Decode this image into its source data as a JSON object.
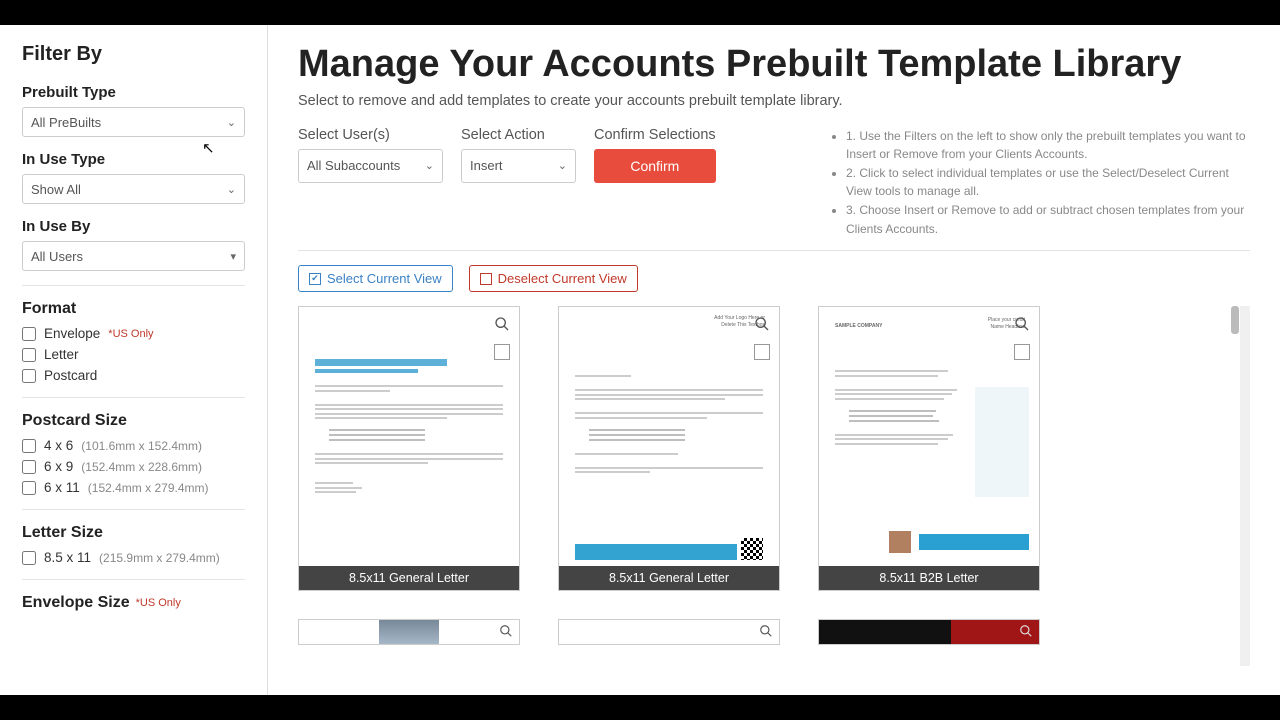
{
  "sidebar": {
    "title": "Filter By",
    "prebuilt_type": {
      "label": "Prebuilt Type",
      "value": "All PreBuilts"
    },
    "in_use_type": {
      "label": "In Use Type",
      "value": "Show All"
    },
    "in_use_by": {
      "label": "In Use By",
      "value": "All Users"
    },
    "format": {
      "title": "Format",
      "options": [
        {
          "label": "Envelope",
          "note": "*US Only"
        },
        {
          "label": "Letter"
        },
        {
          "label": "Postcard"
        }
      ]
    },
    "postcard_size": {
      "title": "Postcard Size",
      "options": [
        {
          "label": "4 x 6",
          "dims": "(101.6mm x 152.4mm)"
        },
        {
          "label": "6 x 9",
          "dims": "(152.4mm x 228.6mm)"
        },
        {
          "label": "6 x 11",
          "dims": "(152.4mm x 279.4mm)"
        }
      ]
    },
    "letter_size": {
      "title": "Letter Size",
      "options": [
        {
          "label": "8.5 x 11",
          "dims": "(215.9mm x 279.4mm)"
        }
      ]
    },
    "envelope_size": {
      "title": "Envelope Size",
      "note": "*US Only"
    }
  },
  "main": {
    "title": "Manage Your Accounts Prebuilt Template Library",
    "subtitle": "Select to remove and add templates to create your accounts prebuilt template library.",
    "select_users": {
      "label": "Select User(s)",
      "value": "All Subaccounts"
    },
    "select_action": {
      "label": "Select Action",
      "value": "Insert"
    },
    "confirm_label_section": "Confirm Selections",
    "confirm_btn": "Confirm",
    "instructions": [
      "1. Use the Filters on the left to show only the prebuilt templates you want to Insert or Remove from your Clients Accounts.",
      "2. Click to select individual templates or use the Select/Deselect Current View tools to manage all.",
      "3. Choose Insert or Remove to add or subtract chosen templates from your Clients Accounts."
    ],
    "select_view_btn": "Select Current View",
    "deselect_view_btn": "Deselect Current View",
    "cards": [
      {
        "caption": "8.5x11 General Letter"
      },
      {
        "caption": "8.5x11 General Letter"
      },
      {
        "caption": "8.5x11 B2B Letter"
      }
    ]
  }
}
